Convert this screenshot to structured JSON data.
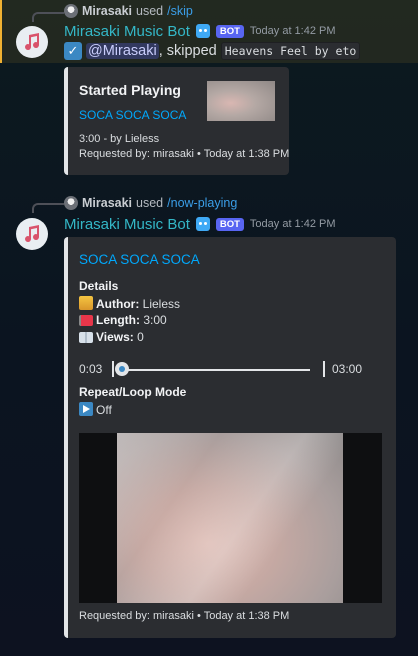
{
  "messages": [
    {
      "reply": {
        "user": "Mirasaki",
        "used": "used",
        "command": "/skip"
      },
      "author": "Mirasaki Music Bot",
      "badge": "BOT",
      "timestamp": "Today at 1:42 PM",
      "content": {
        "mention": "@Mirasaki",
        "text": ", skipped",
        "code": "Heavens Feel by eto"
      },
      "embed": {
        "title": "Started Playing",
        "track_link": "SOCA SOCA SOCA",
        "duration_line": "3:00 - by Lieless",
        "footer": "Requested by: mirasaki • Today at 1:38 PM"
      }
    },
    {
      "reply": {
        "user": "Mirasaki",
        "used": "used",
        "command": "/now-playing"
      },
      "author": "Mirasaki Music Bot",
      "badge": "BOT",
      "timestamp": "Today at 1:42 PM",
      "embed": {
        "track_link": "SOCA SOCA SOCA",
        "details_heading": "Details",
        "author_label": "Author:",
        "author_value": "Lieless",
        "length_label": "Length:",
        "length_value": "3:00",
        "views_label": "Views:",
        "views_value": "0",
        "progress": {
          "current": "0:03",
          "total": "03:00",
          "fraction": 0.017
        },
        "repeat_heading": "Repeat/Loop Mode",
        "repeat_value": "Off",
        "footer": "Requested by: mirasaki • Today at 1:38 PM"
      }
    }
  ],
  "icons": [
    "music-note-avatar-icon",
    "robot-icon",
    "check-icon",
    "crown-icon",
    "flag-icon",
    "book-icon",
    "play-icon"
  ],
  "colors": {
    "bot_name": "#34b7c7",
    "link": "#00a8fc",
    "badge": "#5865f2",
    "highlight": "#f0b132"
  }
}
